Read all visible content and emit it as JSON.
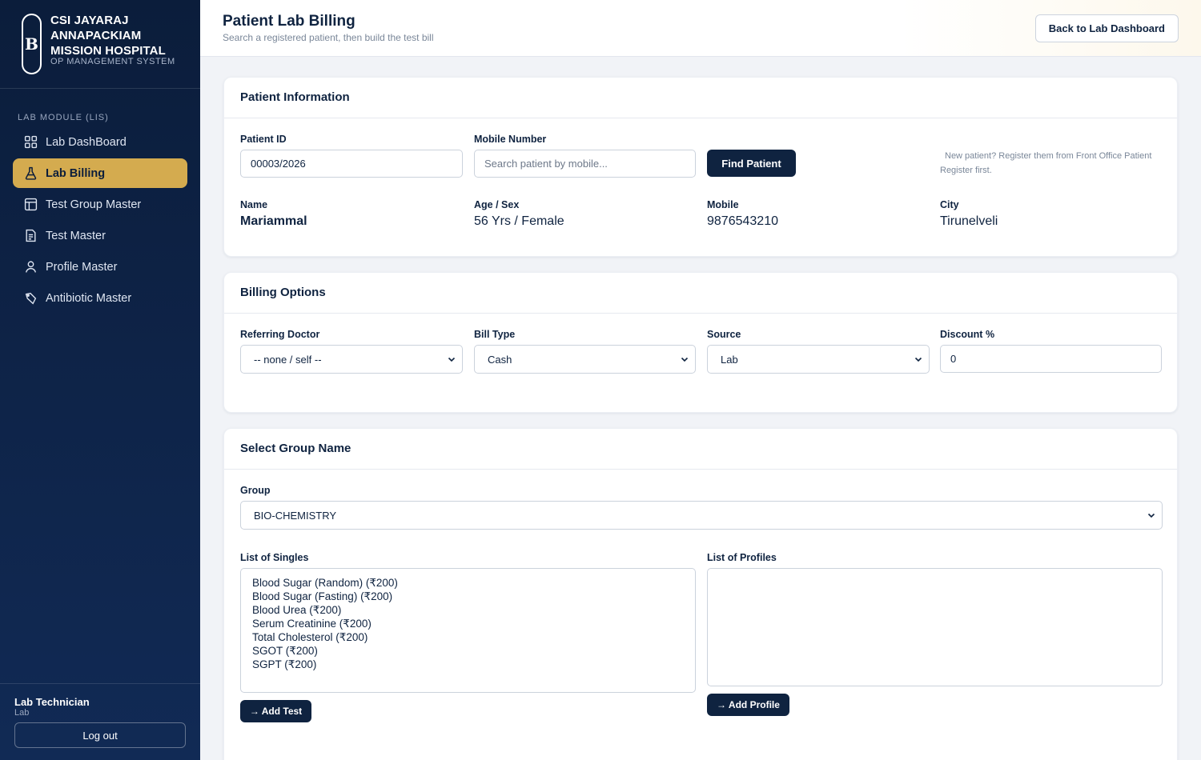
{
  "sidebar": {
    "brand_name": "CSI JAYARAJ ANNAPACKIAM MISSION HOSPITAL",
    "brand_sub": "OP MANAGEMENT SYSTEM",
    "logo_letter": "B",
    "section_label": "LAB MODULE (LIS)",
    "items": [
      {
        "label": "Lab DashBoard",
        "icon": "grid-icon",
        "active": false
      },
      {
        "label": "Lab Billing",
        "icon": "flask-icon",
        "active": true
      },
      {
        "label": "Test Group Master",
        "icon": "table-icon",
        "active": false
      },
      {
        "label": "Test Master",
        "icon": "document-icon",
        "active": false
      },
      {
        "label": "Profile Master",
        "icon": "user-icon",
        "active": false
      },
      {
        "label": "Antibiotic Master",
        "icon": "pill-icon",
        "active": false
      }
    ],
    "user_name": "Lab Technician",
    "user_role": "Lab",
    "logout_label": "Log out"
  },
  "header": {
    "title": "Patient Lab Billing",
    "subtitle": "Search a registered patient, then build the test bill",
    "back_label": "Back to Lab Dashboard"
  },
  "patient": {
    "title": "Patient Information",
    "id_label": "Patient ID",
    "id_value": "00003/2026",
    "mobile_label": "Mobile Number",
    "mobile_placeholder": "Search patient by mobile...",
    "find_label": "Find Patient",
    "hint": "New patient? Register them from Front Office Patient Register first.",
    "name_label": "Name",
    "name_value": "Mariammal",
    "age_label": "Age / Sex",
    "age_value": "56 Yrs / Female",
    "mob_label": "Mobile",
    "mob_value": "9876543210",
    "city_label": "City",
    "city_value": "Tirunelveli"
  },
  "billing": {
    "title": "Billing Options",
    "doctor_label": "Referring Doctor",
    "doctor_value": "-- none / self --",
    "billtype_label": "Bill Type",
    "billtype_value": "Cash",
    "source_label": "Source",
    "source_value": "Lab",
    "discount_label": "Discount %",
    "discount_value": "0"
  },
  "group": {
    "title": "Select Group Name",
    "group_label": "Group",
    "group_value": "BIO-CHEMISTRY",
    "singles_label": "List of Singles",
    "singles": [
      "Blood Sugar (Random) (₹200)",
      "Blood Sugar (Fasting) (₹200)",
      "Blood Urea (₹200)",
      "Serum Creatinine (₹200)",
      "Total Cholesterol (₹200)",
      "SGOT (₹200)",
      "SGPT (₹200)"
    ],
    "add_test_label": "→ Add Test",
    "profiles_label": "List of Profiles",
    "add_profile_label": "→ Add Profile"
  },
  "colors": {
    "sidebar_bg": "#0b1d3b",
    "accent_gold": "#d4ab4f",
    "primary_dark": "#0f2340"
  }
}
